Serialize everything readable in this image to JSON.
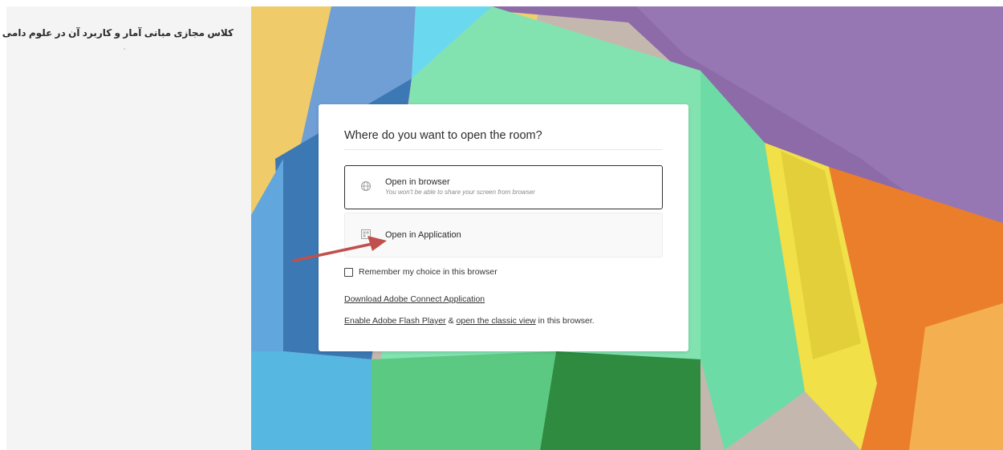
{
  "sidebar": {
    "room_title": "کلاس مجازی مبانی آمار و کاربرد آن در علوم دامی"
  },
  "dialog": {
    "title": "Where do you want to open the room?",
    "options": [
      {
        "label": "Open in browser",
        "sublabel": "You won't be able to share your screen from browser",
        "icon": "globe-icon",
        "selected": true
      },
      {
        "label": "Open in Application",
        "icon": "application-icon",
        "selected": false
      }
    ],
    "remember": {
      "label": "Remember my choice in this browser",
      "checked": false
    },
    "download_link": "Download Adobe Connect Application",
    "flash_link": "Enable Adobe Flash Player",
    "flash_ampersand": "&",
    "classic_link": "open the classic view",
    "classic_suffix": "in this browser."
  },
  "colors": {
    "dialog_bg": "#ffffff",
    "selected_border": "#2f2f2f",
    "sidebar_bg": "#f4f4f4",
    "arrow": "#c0504d"
  }
}
